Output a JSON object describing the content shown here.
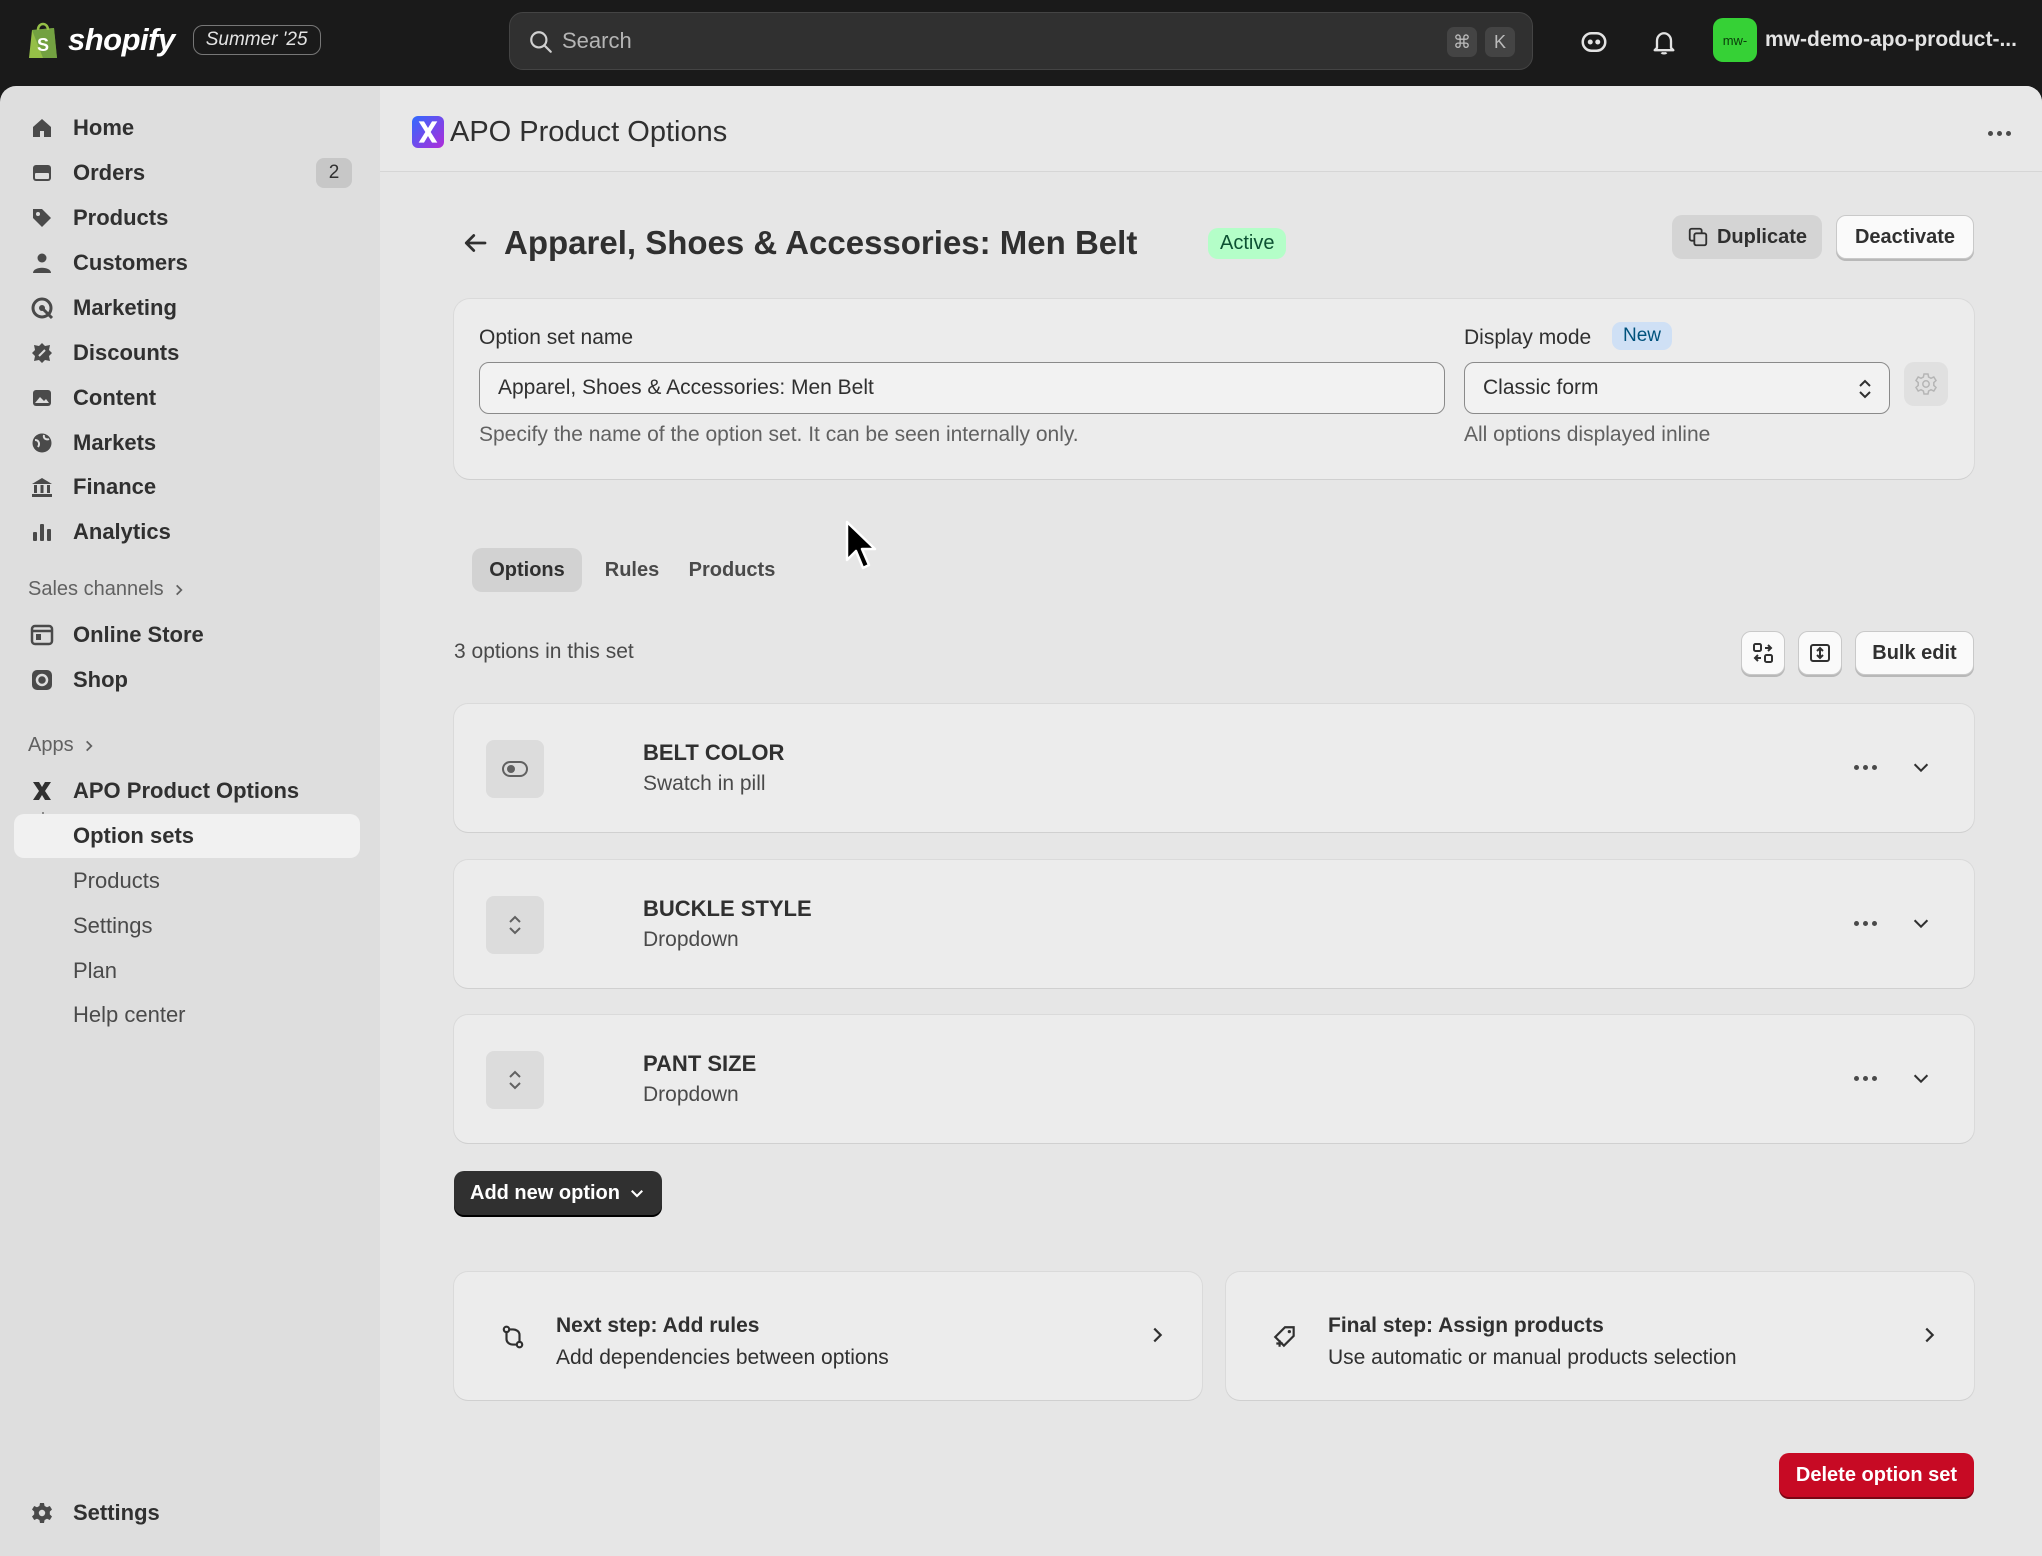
{
  "topbar": {
    "brand": "shopify",
    "edition_badge": "Summer '25",
    "search_placeholder": "Search",
    "shortcut_keys": [
      "⌘",
      "K"
    ],
    "store_avatar_text": "mw-",
    "store_name": "mw-demo-apo-product-..."
  },
  "sidebar": {
    "main_items": [
      {
        "label": "Home",
        "icon": "home-icon"
      },
      {
        "label": "Orders",
        "icon": "orders-icon",
        "badge": "2"
      },
      {
        "label": "Products",
        "icon": "tag-icon"
      },
      {
        "label": "Customers",
        "icon": "person-icon"
      },
      {
        "label": "Marketing",
        "icon": "target-icon"
      },
      {
        "label": "Discounts",
        "icon": "discount-icon"
      },
      {
        "label": "Content",
        "icon": "image-icon"
      },
      {
        "label": "Markets",
        "icon": "globe-icon"
      },
      {
        "label": "Finance",
        "icon": "bank-icon"
      },
      {
        "label": "Analytics",
        "icon": "bar-chart-icon"
      }
    ],
    "sales_channels_label": "Sales channels",
    "sales_channels": [
      {
        "label": "Online Store",
        "icon": "store-icon"
      },
      {
        "label": "Shop",
        "icon": "shop-icon"
      }
    ],
    "apps_label": "Apps",
    "app_name": "APO Product Options",
    "app_subitems": [
      "Option sets",
      "Products",
      "Settings",
      "Plan",
      "Help center"
    ],
    "settings_label": "Settings"
  },
  "app_header": {
    "title": "APO Product Options"
  },
  "page": {
    "title": "Apparel, Shoes & Accessories: Men Belt",
    "status": "Active",
    "duplicate_label": "Duplicate",
    "deactivate_label": "Deactivate"
  },
  "form": {
    "name_label": "Option set name",
    "name_value": "Apparel, Shoes & Accessories: Men Belt",
    "name_help": "Specify the name of the option set. It can be seen internally only.",
    "display_mode_label": "Display mode",
    "display_mode_badge": "New",
    "display_mode_value": "Classic form",
    "display_mode_help": "All options displayed inline"
  },
  "tabs": [
    "Options",
    "Rules",
    "Products"
  ],
  "options_summary": "3 options in this set",
  "bulk_edit_label": "Bulk edit",
  "options": [
    {
      "name": "BELT COLOR",
      "type": "Swatch in pill",
      "icon": "swatch-icon"
    },
    {
      "name": "BUCKLE STYLE",
      "type": "Dropdown",
      "icon": "dropdown-icon"
    },
    {
      "name": "PANT SIZE",
      "type": "Dropdown",
      "icon": "dropdown-icon"
    }
  ],
  "add_option_label": "Add new option",
  "steps": [
    {
      "title": "Next step: Add rules",
      "desc": "Add dependencies between options",
      "icon": "rules-icon"
    },
    {
      "title": "Final step: Assign products",
      "desc": "Use automatic or manual products selection",
      "icon": "tag-plus-icon"
    }
  ],
  "delete_label": "Delete option set",
  "colors": {
    "topbar": "#1a1a1a",
    "active_badge_bg": "#b4fec8",
    "danger": "#c70a24",
    "store_avatar": "#36d136"
  }
}
